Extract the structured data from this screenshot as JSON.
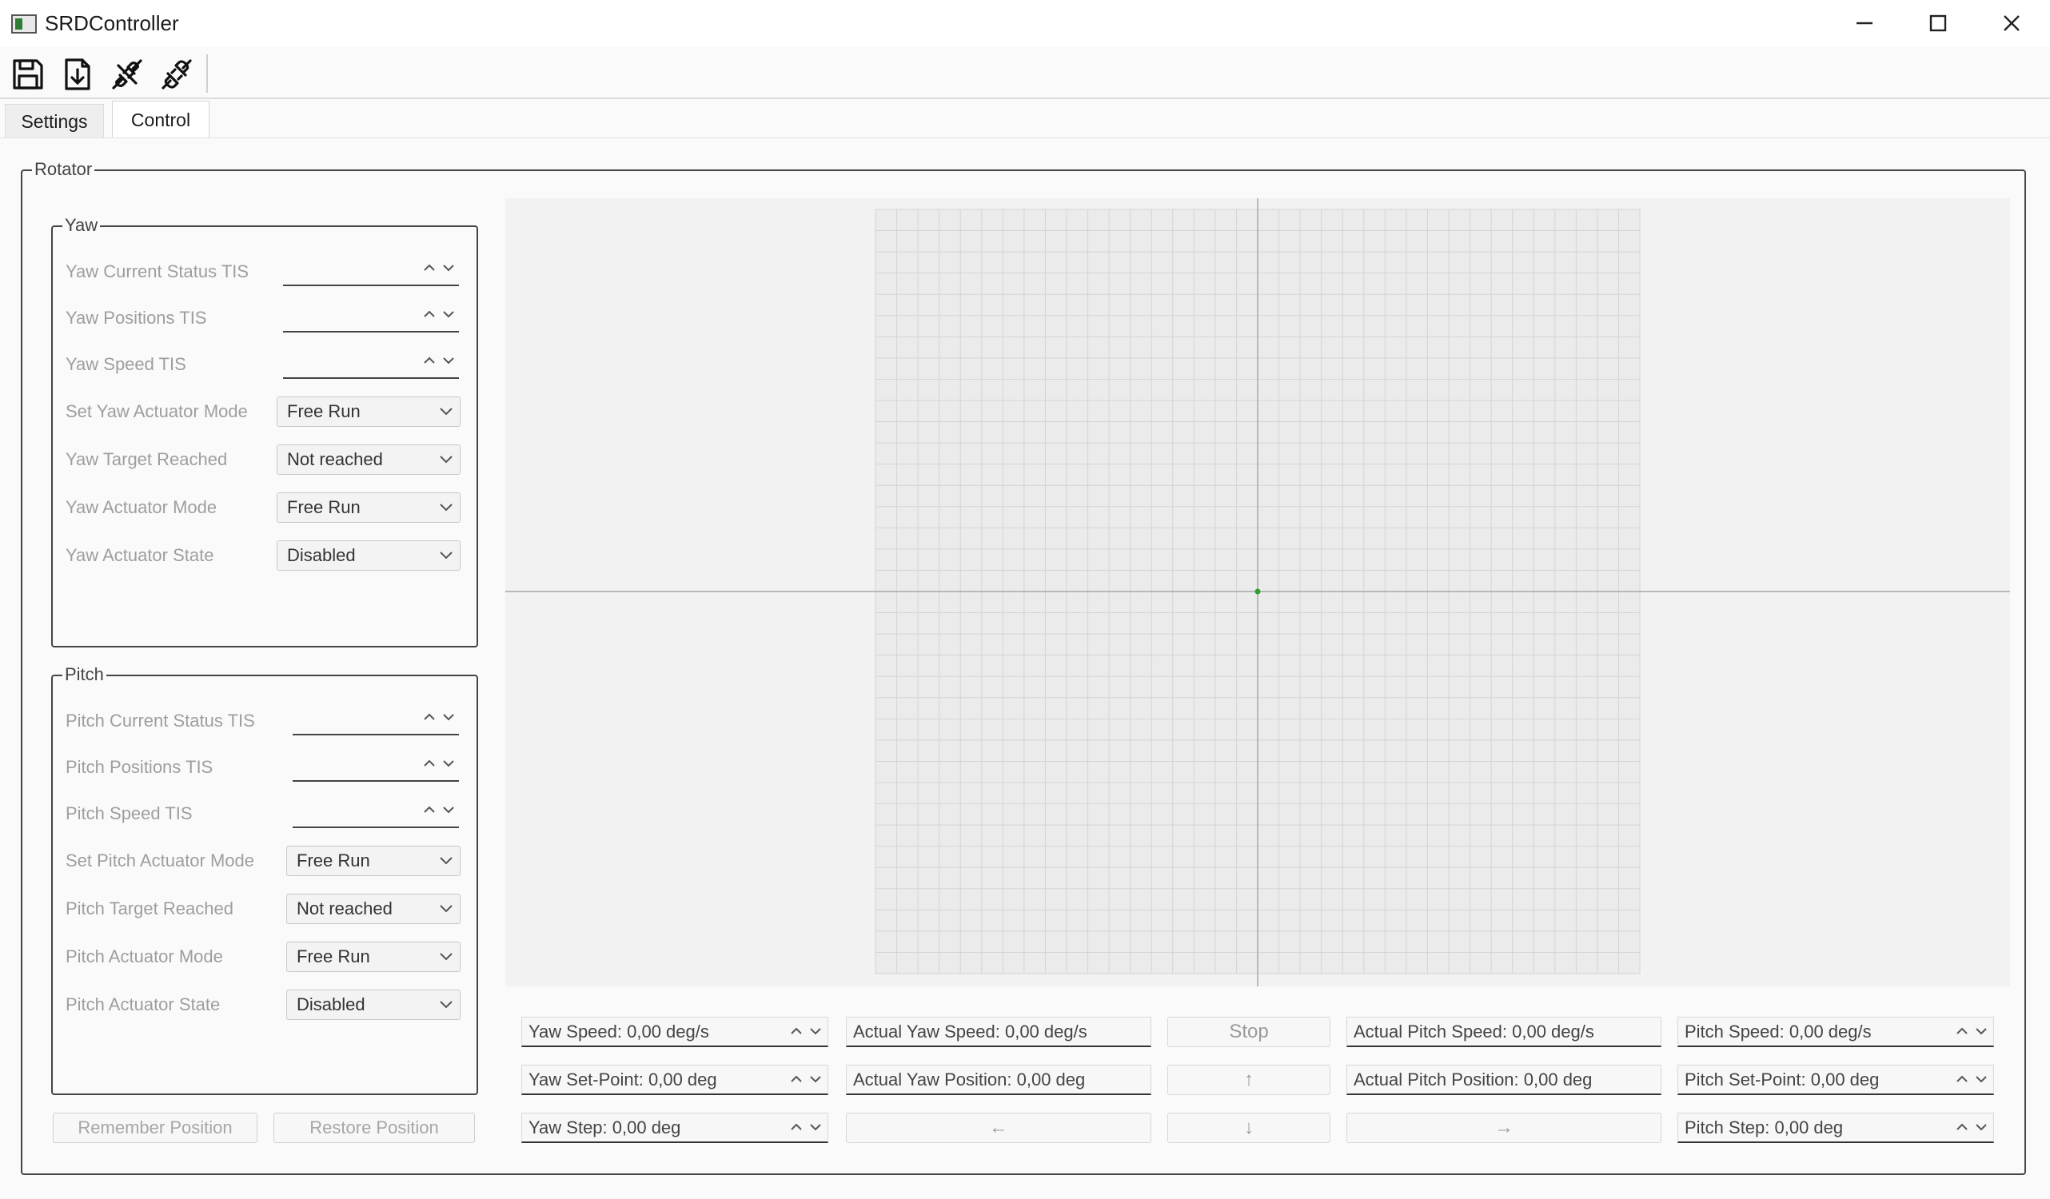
{
  "window": {
    "title": "SRDController",
    "controls": [
      "minimize-icon",
      "maximize-icon",
      "close-icon"
    ]
  },
  "toolbar": {
    "buttons": [
      {
        "icon": "save-icon"
      },
      {
        "icon": "import-icon"
      },
      {
        "icon": "connect-icon"
      },
      {
        "icon": "disconnect-icon"
      }
    ]
  },
  "tabs": [
    {
      "label": "Settings",
      "active": false
    },
    {
      "label": "Control",
      "active": true
    }
  ],
  "rotator": {
    "title": "Rotator",
    "yaw": {
      "title": "Yaw",
      "current_status_label": "Yaw Current Status TIS",
      "current_status_value": "",
      "positions_label": "Yaw Positions TIS",
      "positions_value": "",
      "speed_label": "Yaw Speed TIS",
      "speed_value": "",
      "set_mode_label": "Set Yaw Actuator Mode",
      "set_mode_value": "Free Run",
      "target_label": "Yaw Target Reached",
      "target_value": "Not reached",
      "mode_label": "Yaw Actuator Mode",
      "mode_value": "Free Run",
      "state_label": "Yaw Actuator State",
      "state_value": "Disabled"
    },
    "pitch": {
      "title": "Pitch",
      "current_status_label": "Pitch Current Status TIS",
      "current_status_value": "",
      "positions_label": "Pitch Positions TIS",
      "positions_value": "",
      "speed_label": "Pitch Speed TIS",
      "speed_value": "",
      "set_mode_label": "Set Pitch Actuator Mode",
      "set_mode_value": "Free Run",
      "target_label": "Pitch Target Reached",
      "target_value": "Not reached",
      "mode_label": "Pitch Actuator Mode",
      "mode_value": "Free Run",
      "state_label": "Pitch Actuator State",
      "state_value": "Disabled"
    },
    "remember_label": "Remember Position",
    "restore_label": "Restore Position"
  },
  "plot": {
    "grid_divisions": 36,
    "point": {
      "yaw": 0,
      "pitch": 0
    },
    "point_color": "#2ca02c",
    "grid_color": "#d4d4d4",
    "axis_color": "#a8a8a8",
    "background": "#ebebeb"
  },
  "controls": {
    "yaw_speed": "Yaw Speed: 0,00 deg/s",
    "yaw_setpoint": "Yaw Set-Point: 0,00 deg",
    "yaw_step": "Yaw Step: 0,00 deg",
    "actual_yaw_speed": "Actual Yaw Speed: 0,00 deg/s",
    "actual_yaw_position": "Actual Yaw Position: 0,00 deg",
    "left_arrow": "←",
    "stop_label": "Stop",
    "up_arrow": "↑",
    "down_arrow": "↓",
    "actual_pitch_speed": "Actual Pitch Speed: 0,00 deg/s",
    "actual_pitch_position": "Actual Pitch Position: 0,00 deg",
    "right_arrow": "→",
    "pitch_speed": "Pitch Speed: 0,00 deg/s",
    "pitch_setpoint": "Pitch Set-Point: 0,00 deg",
    "pitch_step": "Pitch Step: 0,00 deg"
  }
}
